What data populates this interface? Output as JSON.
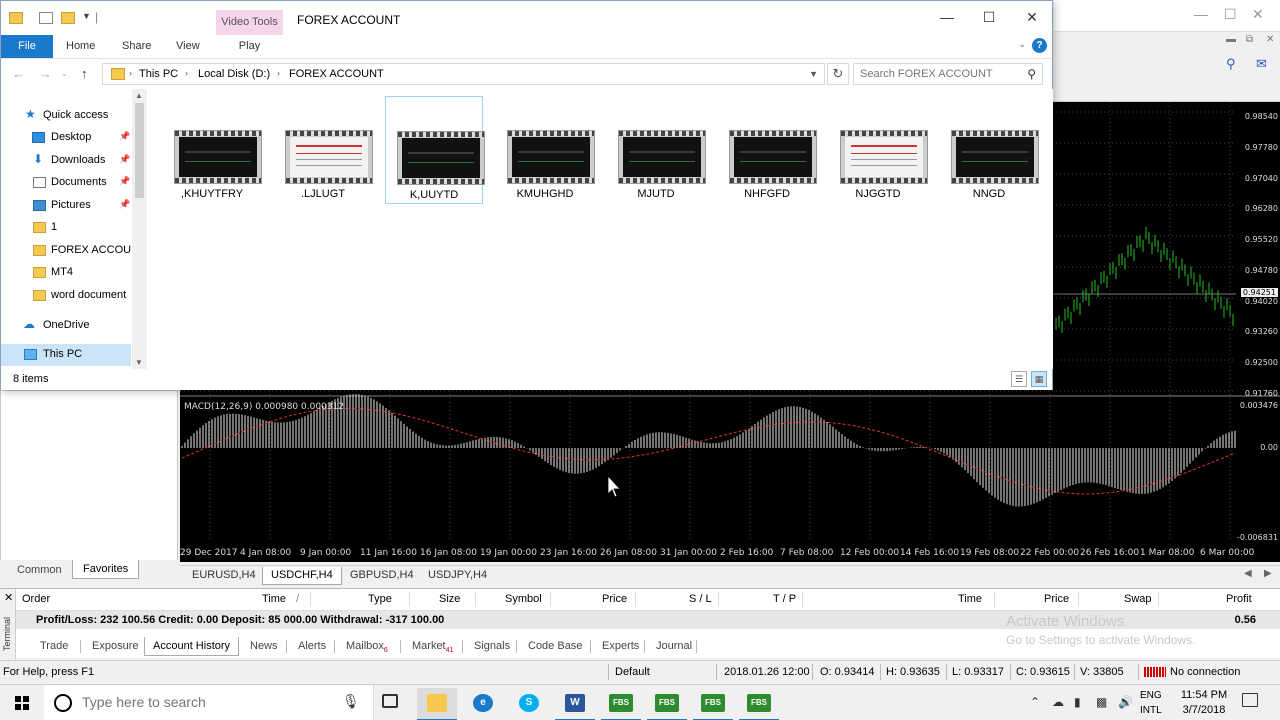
{
  "mt4": {
    "price_ticks": [
      "0.98540",
      "0.97780",
      "0.97040",
      "0.96280",
      "0.95520",
      "0.94780",
      "0.94251",
      "0.94020",
      "0.93260",
      "0.92500",
      "0.91760"
    ],
    "macd_ticks": [
      "0.003476",
      "0.00",
      "-0.006831"
    ],
    "macd_label": "MACD(12,26,9) 0.000980 0.000312",
    "date_ticks": [
      "29 Dec 2017",
      "4 Jan 08:00",
      "9 Jan 00:00",
      "11 Jan 16:00",
      "16 Jan 08:00",
      "19 Jan 00:00",
      "23 Jan 16:00",
      "26 Jan 08:00",
      "31 Jan 00:00",
      "2 Feb 16:00",
      "7 Feb 08:00",
      "12 Feb 00:00",
      "14 Feb 16:00",
      "19 Feb 08:00",
      "22 Feb 00:00",
      "26 Feb 16:00",
      "1 Mar 08:00",
      "6 Mar 00:00"
    ],
    "navigator_tabs": [
      "Common",
      "Favorites"
    ],
    "chart_tabs": [
      "EURUSD,H4",
      "USDCHF,H4",
      "GBPUSD,H4",
      "USDJPY,H4"
    ],
    "active_chart_tab": "USDCHF,H4",
    "terminal": {
      "side_label": "Terminal",
      "columns": [
        "Order",
        "Time",
        "Type",
        "Size",
        "Symbol",
        "Price",
        "S / L",
        "T / P",
        "Time",
        "Price",
        "Swap",
        "Profit"
      ],
      "sort_marker": "/",
      "summary": "Profit/Loss: 232 100.56  Credit: 0.00  Deposit: 85 000.00  Withdrawal: -317 100.00",
      "profit": "0.56",
      "tabs": [
        "Trade",
        "Exposure",
        "Account History",
        "News",
        "Alerts",
        "Mailbox",
        "Market",
        "Signals",
        "Code Base",
        "Experts",
        "Journal"
      ],
      "mailbox_badge": "6",
      "market_badge": "41",
      "active_tab": "Account History"
    },
    "watermark": {
      "line1": "Activate Windows",
      "line2": "Go to Settings to activate Windows."
    },
    "status": {
      "help": "For Help, press F1",
      "profile": "Default",
      "datetime": "2018.01.26 12:00",
      "open": "O: 0.93414",
      "high": "H: 0.93635",
      "low": "L: 0.93317",
      "close": "C: 0.93615",
      "volume": "V: 33805",
      "connection": "No connection"
    }
  },
  "explorer": {
    "video_tools": "Video Tools",
    "title": "FOREX ACCOUNT",
    "ribbon_tabs": {
      "file": "File",
      "home": "Home",
      "share": "Share",
      "view": "View",
      "play": "Play"
    },
    "breadcrumb": [
      "This PC",
      "Local Disk (D:)",
      "FOREX ACCOUNT"
    ],
    "search_placeholder": "Search FOREX ACCOUNT",
    "nav": [
      {
        "label": "Quick access",
        "icon": "star-icon"
      },
      {
        "label": "Desktop",
        "icon": "desktop-icon",
        "pinned": true
      },
      {
        "label": "Downloads",
        "icon": "download-icon",
        "pinned": true
      },
      {
        "label": "Documents",
        "icon": "documents-icon",
        "pinned": true
      },
      {
        "label": "Pictures",
        "icon": "pictures-icon",
        "pinned": true
      },
      {
        "label": "1",
        "icon": "folder-icon"
      },
      {
        "label": "FOREX ACCOUN",
        "icon": "folder-icon"
      },
      {
        "label": "MT4",
        "icon": "folder-icon"
      },
      {
        "label": "word document",
        "icon": "folder-icon"
      },
      {
        "label": "OneDrive",
        "icon": "cloud-icon"
      },
      {
        "label": "This PC",
        "icon": "pc-icon",
        "selected": true
      }
    ],
    "files": [
      {
        "name": ",KHUYTFRY",
        "thumb": "dark"
      },
      {
        "name": ".LJLUGT",
        "thumb": "light"
      },
      {
        "name": "K,UUYTD",
        "thumb": "dark",
        "selected": true
      },
      {
        "name": "KMUHGHD",
        "thumb": "dark"
      },
      {
        "name": "MJUTD",
        "thumb": "dark"
      },
      {
        "name": "NHFGFD",
        "thumb": "dark"
      },
      {
        "name": "NJGGTD",
        "thumb": "light"
      },
      {
        "name": "NNGD",
        "thumb": "dark"
      }
    ],
    "item_count": "8 items"
  },
  "taskbar": {
    "search_placeholder": "Type here to search",
    "apps": [
      "file-explorer-icon",
      "edge-icon",
      "skype-icon",
      "word-icon",
      "fbs-icon",
      "fbs-icon",
      "fbs-icon",
      "fbs-icon"
    ],
    "app_letters": {
      "word": "W",
      "fbs": "FBS",
      "skype": "S",
      "edge": "e"
    },
    "lang_line1": "ENG",
    "lang_line2": "INTL",
    "time": "11:54 PM",
    "date": "3/7/2018"
  },
  "colors": {
    "accent": "#1979ca",
    "candle": "#26c026",
    "macd_hist": "#e8e8e8",
    "macd_signal": "#e03030",
    "chart_bg": "#000000"
  }
}
